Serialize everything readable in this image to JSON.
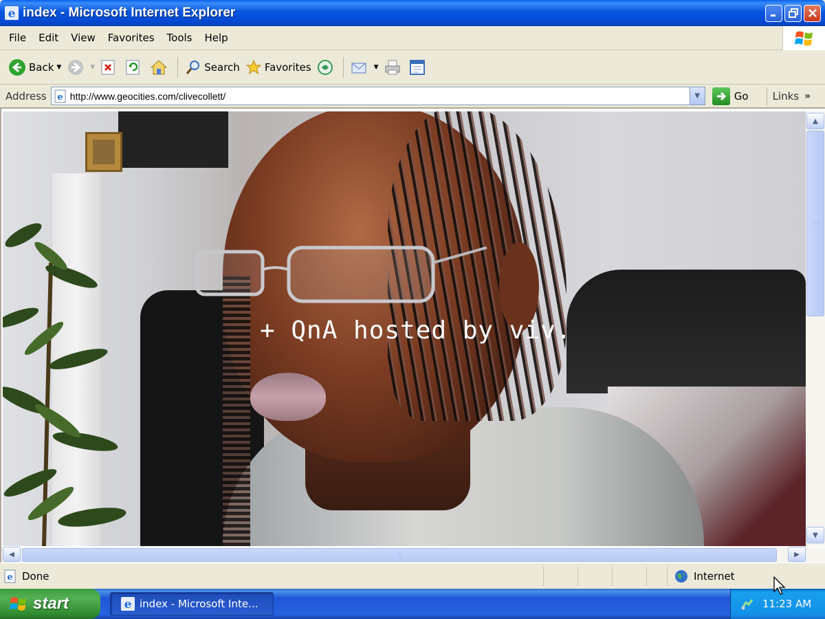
{
  "window": {
    "title": "index - Microsoft Internet Explorer",
    "app_icon": "ie-icon",
    "controls": {
      "minimize": "minimize-icon",
      "maximize": "restore-icon",
      "close": "close-icon"
    }
  },
  "menu": {
    "items": [
      "File",
      "Edit",
      "View",
      "Favorites",
      "Tools",
      "Help"
    ]
  },
  "toolbar": {
    "back_label": "Back",
    "search_label": "Search",
    "favorites_label": "Favorites"
  },
  "address": {
    "label": "Address",
    "url": "http://www.geocities.com/clivecollett/",
    "go_label": "Go",
    "links_label": "Links",
    "links_more": "»"
  },
  "content": {
    "overlay_text": "+ QnA hosted by viv. "
  },
  "scrollbar": {
    "grip": "⦙⦙⦙"
  },
  "status": {
    "text": "Done",
    "zone": "Internet"
  },
  "taskbar": {
    "start_label": "start",
    "task_label": "index - Microsoft Inte...",
    "clock": "11:23 AM"
  },
  "colors": {
    "titlebar": "#0756df",
    "taskbar": "#2157d7",
    "start_green": "#54b154",
    "chrome": "#ece9d8"
  }
}
